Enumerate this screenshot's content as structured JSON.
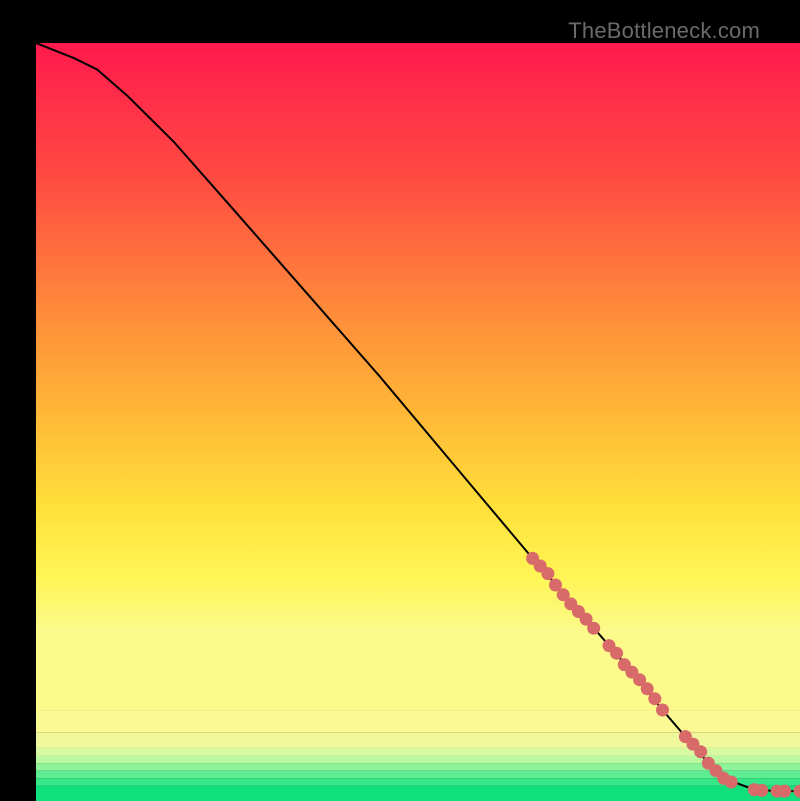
{
  "watermark": "TheBottleneck.com",
  "chart_data": {
    "type": "line",
    "title": "",
    "xlabel": "",
    "ylabel": "",
    "xlim": [
      0,
      100
    ],
    "ylim": [
      0,
      100
    ],
    "curve": {
      "x": [
        0,
        5,
        8,
        12,
        18,
        25,
        35,
        45,
        55,
        65,
        72,
        78,
        82,
        85,
        88,
        90,
        94,
        97,
        100
      ],
      "y": [
        100,
        98,
        96.5,
        93,
        87,
        79,
        67.5,
        56,
        44,
        32,
        24,
        17,
        12,
        8.5,
        5,
        3,
        1.5,
        1.3,
        1.3
      ]
    },
    "scatter": {
      "x": [
        65,
        66,
        67,
        68,
        69,
        70,
        71,
        72,
        73,
        75,
        76,
        77,
        78,
        79,
        80,
        81,
        82,
        85,
        86,
        87,
        88,
        89,
        90,
        91,
        94,
        95,
        97,
        98,
        100
      ],
      "y": [
        32,
        31,
        30,
        28.5,
        27.2,
        26,
        25,
        24,
        22.8,
        20.5,
        19.5,
        18,
        17,
        16,
        14.8,
        13.5,
        12,
        8.5,
        7.5,
        6.5,
        5,
        4,
        3,
        2.5,
        1.5,
        1.4,
        1.3,
        1.3,
        1.3
      ]
    },
    "background_bands": [
      {
        "label": "emerald",
        "from": 0.0,
        "to": 2.0,
        "color": "#10e07c"
      },
      {
        "label": "mint",
        "from": 2.0,
        "to": 3.0,
        "color": "#34e788"
      },
      {
        "label": "mint-2",
        "from": 3.0,
        "to": 4.0,
        "color": "#5ded92"
      },
      {
        "label": "lime-1",
        "from": 4.0,
        "to": 5.0,
        "color": "#8df49a"
      },
      {
        "label": "lime-2",
        "from": 5.0,
        "to": 6.0,
        "color": "#bcf89f"
      },
      {
        "label": "lime-3",
        "from": 6.0,
        "to": 7.0,
        "color": "#d9f9a0"
      },
      {
        "label": "pale-y",
        "from": 7.0,
        "to": 9.0,
        "color": "#eff99c"
      },
      {
        "label": "cream",
        "from": 9.0,
        "to": 12.0,
        "color": "#fbf994"
      }
    ],
    "gradient_stops": [
      {
        "offset": 0,
        "color": "#ff1a4d"
      },
      {
        "offset": 20,
        "color": "#ff4a42"
      },
      {
        "offset": 40,
        "color": "#ff8a3a"
      },
      {
        "offset": 55,
        "color": "#ffb637"
      },
      {
        "offset": 70,
        "color": "#ffe13a"
      },
      {
        "offset": 80,
        "color": "#fff555"
      },
      {
        "offset": 88,
        "color": "#fcfa8a"
      }
    ],
    "series_color": "#d86a6a",
    "curve_color": "#000000"
  }
}
